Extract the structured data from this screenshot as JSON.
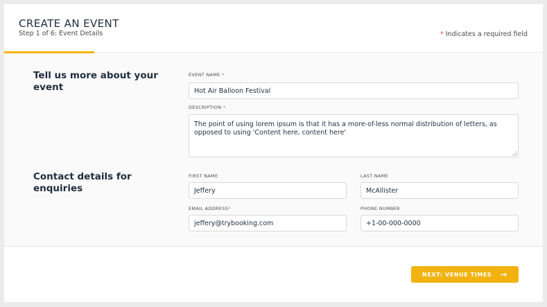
{
  "header": {
    "title": "CREATE AN EVENT",
    "step": "Step 1 of 6: Event Details",
    "required_star": "*",
    "required_text": " Indicates a required field"
  },
  "sections": {
    "event": {
      "title": "Tell us more about your event"
    },
    "contact": {
      "title": "Contact details for enquiries"
    }
  },
  "fields": {
    "event_name": {
      "label": "EVENT NAME",
      "star": "*",
      "value": "Hot Air Balloon Festival"
    },
    "description": {
      "label": "DESCRIPTION",
      "star": "*",
      "value": "The point of using lorem ipsum is that it has a more-of-less normal distribution of letters, as opposed to using 'Content here, content here'"
    },
    "first_name": {
      "label": "FIRST NAME",
      "value": "Jeffery"
    },
    "last_name": {
      "label": "LAST NAME",
      "value": "McAllister"
    },
    "email": {
      "label": "EMAIL ADDRESS",
      "star": "*",
      "value": "jeffery@trybooking.com"
    },
    "phone": {
      "label": "PHONE NUMBER",
      "value": "+1-00-000-0000"
    }
  },
  "footer": {
    "next_label": "NEXT: VENUE TIMES",
    "next_icon": "arrow-right-icon"
  },
  "colors": {
    "accent": "#f2b311",
    "required": "#e8542d"
  },
  "progress": {
    "step": 1,
    "total": 6
  }
}
